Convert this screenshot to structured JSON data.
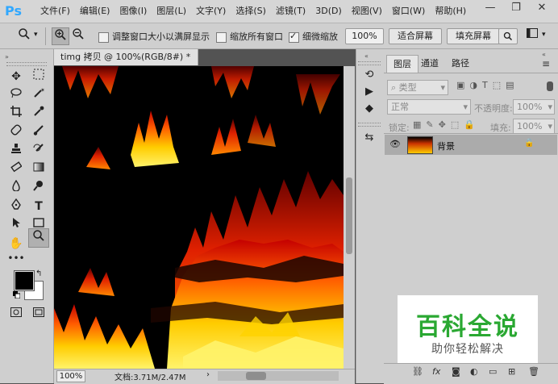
{
  "app": {
    "logo": "Ps",
    "menus": [
      "文件(F)",
      "编辑(E)",
      "图像(I)",
      "图层(L)",
      "文字(Y)",
      "选择(S)",
      "滤镜(T)",
      "3D(D)",
      "视图(V)",
      "窗口(W)",
      "帮助(H)"
    ],
    "window_controls": {
      "minimize": "—",
      "restore": "❐",
      "close": "✕"
    }
  },
  "options": {
    "resize_windows_label": "调整窗口大小以满屏显示",
    "resize_windows_checked": false,
    "zoom_all_label": "缩放所有窗口",
    "zoom_all_checked": false,
    "scrubby_label": "细微缩放",
    "scrubby_checked": true,
    "zoom_value": "100%",
    "fit_screen_label": "适合屏幕",
    "fill_screen_label": "填充屏幕"
  },
  "document": {
    "tab_title": "timg 拷贝 @ 100%(RGB/8#) *",
    "zoom_status": "100%",
    "doc_size": "文档:3.71M/2.47M"
  },
  "layers_panel": {
    "tabs": [
      "图层",
      "通道",
      "路径"
    ],
    "filter_kind": "类型",
    "blend_mode": "正常",
    "opacity_label": "不透明度:",
    "opacity_value": "100%",
    "lock_label": "锁定:",
    "fill_label": "填充:",
    "fill_value": "100%",
    "layers": [
      {
        "name": "背景",
        "visible": true,
        "locked": true
      }
    ]
  },
  "watermark": {
    "title": "百科全说",
    "subtitle": "助你轻松解决"
  },
  "colors": {
    "accent": "#31a8ff",
    "watermark_green": "#2aa832",
    "foreground": "#000000",
    "background": "#ffffff"
  }
}
